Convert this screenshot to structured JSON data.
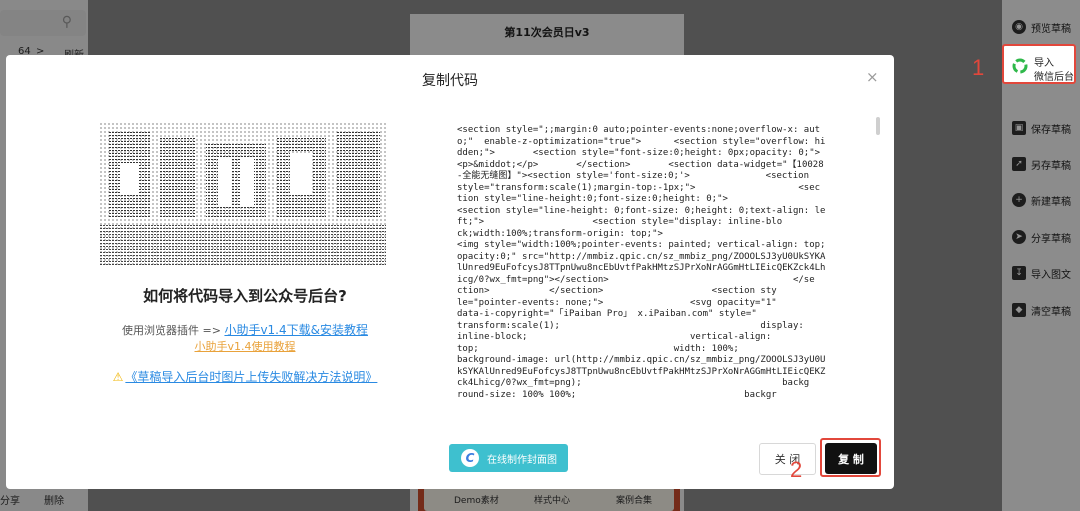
{
  "background": {
    "canvas_title": "第11次会员日v3",
    "left_panel": {
      "row_num": "64",
      "row_arrow": ">",
      "row_action": "刷新",
      "footer_share": "分享",
      "footer_delete": "删除"
    },
    "strip_items": [
      "Demo素材",
      "样式中心",
      "案例合集"
    ]
  },
  "right_toolbar": {
    "preview": "预览草稿",
    "import_line1": "导入",
    "import_line2": "微信后台",
    "save": "保存草稿",
    "save_as": "另存草稿",
    "new": "新建草稿",
    "share": "分享草稿",
    "import_graphic": "导入图文",
    "clear": "清空草稿"
  },
  "markers": {
    "one": "1",
    "two": "2"
  },
  "modal": {
    "title": "复制代码",
    "close_icon_glyph": "×",
    "heading": "如何将代码导入到公众号后台?",
    "plugin_prefix": "使用浏览器插件 => ",
    "plugin_link": "小助手v1.4下载&安装教程",
    "tutorial_link": "小助手v1.4使用教程",
    "warning_link": "《草稿导入后台时图片上传失败解决方法说明》",
    "code": "<section style=\";;margin:0 auto;pointer-events:none;overflow-x: aut\no;\"  enable-z-optimization=\"true\">      <section style=\"overflow: hi\ndden;\">       <section style=\"font-size:0;height: 0px;opacity: 0;\">\n<p>&middot;</p>       </section>       <section data-widget=\"【10028\n-全能无缝图】\"><section style='font-size:0;'>              <section\nstyle=\"transform:scale(1);margin-top:-1px;\">                   <sec\ntion style=\"line-height:0;font-size:0;height: 0;\">\n<section style=\"line-height: 0;font-size: 0;height: 0;text-align: le\nft;\">                    <section style=\"display: inline-blo\nck;width:100%;transform-origin: top;\">\n<img style=\"width:100%;pointer-events: painted; vertical-align: top;\nopacity:0;\" src=\"http://mmbiz.qpic.cn/sz_mmbiz_png/ZOOOLSJ3yU0UkSYKA\nlUnred9EuFofcysJ8TTpnUwu8ncEbUvtfPakHMtzSJPrXoNrAGGmHtLIEicQEKZck4Lh\nicg/0?wx_fmt=png\"></section>                                  </se\nction>           </section>                    <section sty\nle=\"pointer-events: none;\">                <svg opacity=\"1\"\ndata-i-copyright=\"「iPaiban Pro」 x.iPaiban.com\" style=\"\ntransform:scale(1);                                     display:\ninline-block;                              vertical-align:\ntop;                                    width: 100%;\nbackground-image: url(http://mmbiz.qpic.cn/sz_mmbiz_png/ZOOOLSJ3yU0U\nkSYKAlUnred9EuFofcysJ8TTpnUwu8ncEbUvtfPakHMtzSJPrXoNrAGGmHtLIEicQEKZ\nck4Lhicg/0?wx_fmt=png);                                     backg\nround-size: 100% 100%;                               backgr",
    "cover_button": "在线制作封面图",
    "close_button": "关 闭",
    "copy_button": "复 制"
  },
  "colors": {
    "accent_red": "#e2473b",
    "link_blue": "#2a8ae2",
    "teal": "#3ec0cf",
    "orange_link": "#e9a23b"
  }
}
